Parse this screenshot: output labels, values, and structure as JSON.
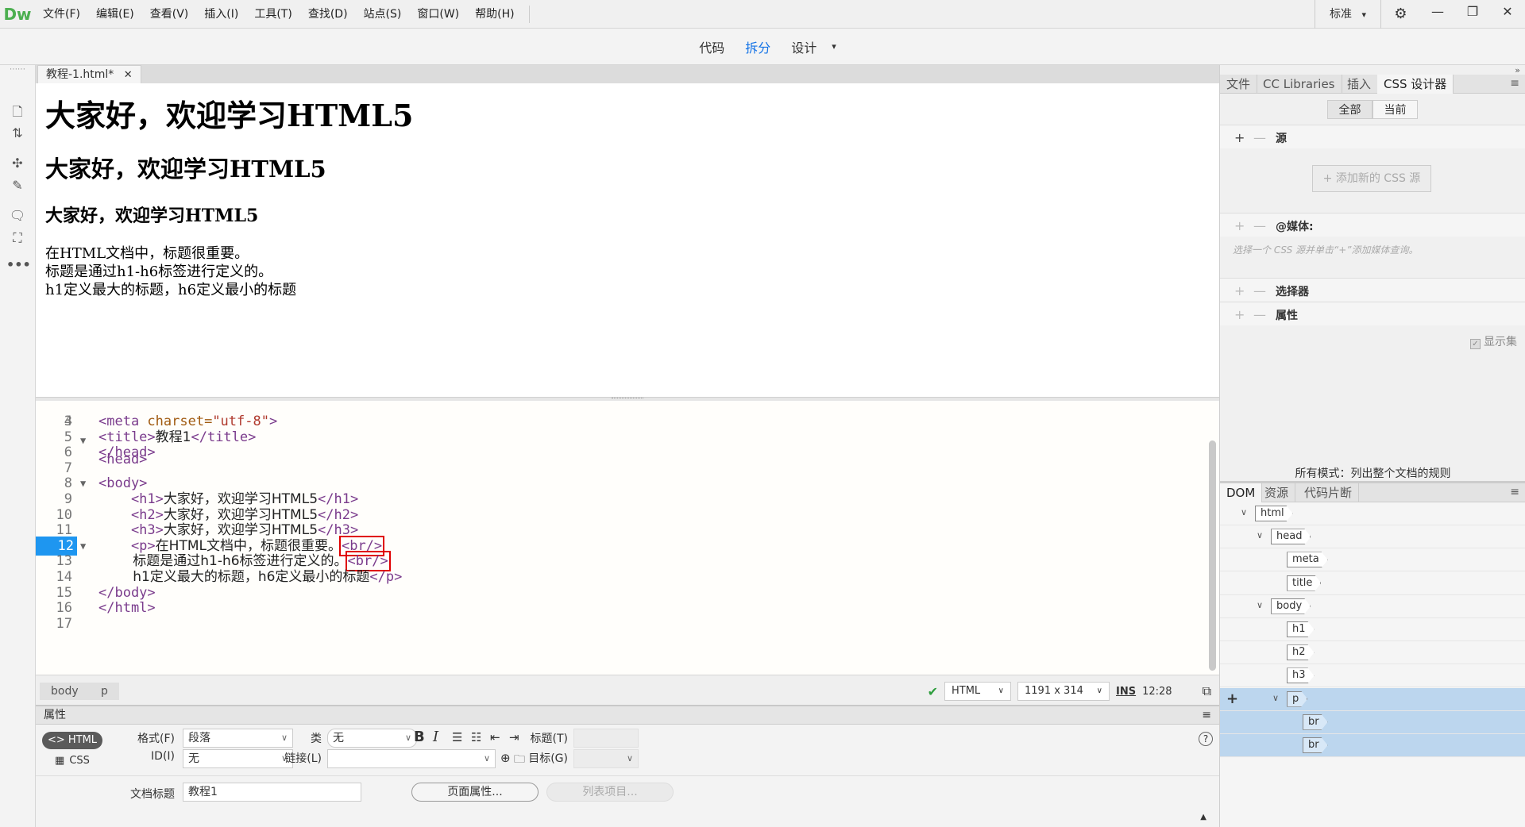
{
  "app": {
    "logo": "Dw"
  },
  "menu": [
    "文件(F)",
    "编辑(E)",
    "查看(V)",
    "插入(I)",
    "工具(T)",
    "查找(D)",
    "站点(S)",
    "窗口(W)",
    "帮助(H)"
  ],
  "workspace": {
    "label": "标准",
    "caret": "▾"
  },
  "window_buttons": {
    "minimize": "—",
    "restore": "❐",
    "close": "✕"
  },
  "view_modes": {
    "code": "代码",
    "split": "拆分",
    "design": "设计",
    "caret": "▾",
    "active": "拆分"
  },
  "document": {
    "tab_label": "教程-1.html*",
    "close": "✕"
  },
  "design_view": {
    "h1": "大家好，欢迎学习HTML5",
    "h2": "大家好，欢迎学习HTML5",
    "h3": "大家好，欢迎学习HTML5",
    "p_lines": [
      "在HTML文档中，标题很重要。",
      "标题是通过h1-h6标签进行定义的。",
      "h1定义最大的标题，h6定义最小的标题"
    ]
  },
  "code_view": {
    "partial_top": "<head>",
    "lines": [
      {
        "num": "4",
        "segments": [
          [
            "tag",
            "<meta "
          ],
          [
            "attr",
            "charset="
          ],
          [
            "str",
            "\"utf-8\""
          ],
          [
            "tag",
            ">"
          ]
        ]
      },
      {
        "num": "5",
        "segments": [
          [
            "tag",
            "<title>"
          ],
          [
            "txt",
            "教程1"
          ],
          [
            "tag",
            "</title>"
          ]
        ]
      },
      {
        "num": "6",
        "segments": [
          [
            "tag",
            "</head>"
          ]
        ]
      },
      {
        "num": "7",
        "segments": []
      },
      {
        "num": "8",
        "fold": "▼",
        "segments": [
          [
            "tag",
            "<body>"
          ]
        ]
      },
      {
        "num": "9",
        "segments": [
          [
            "tag",
            "    <h1>"
          ],
          [
            "txt",
            "大家好，欢迎学习HTML5"
          ],
          [
            "tag",
            "</h1>"
          ]
        ]
      },
      {
        "num": "10",
        "segments": [
          [
            "tag",
            "    <h2>"
          ],
          [
            "txt",
            "大家好，欢迎学习HTML5"
          ],
          [
            "tag",
            "</h2>"
          ]
        ]
      },
      {
        "num": "11",
        "segments": [
          [
            "tag",
            "    <h3>"
          ],
          [
            "txt",
            "大家好，欢迎学习HTML5"
          ],
          [
            "tag",
            "</h3>"
          ]
        ]
      },
      {
        "num": "12",
        "fold": "▼",
        "current": true,
        "segments": [
          [
            "tag",
            "    <p>"
          ],
          [
            "txt",
            "在HTML文档中，标题很重要。"
          ],
          [
            "hl",
            "<br/>"
          ]
        ]
      },
      {
        "num": "13",
        "segments": [
          [
            "txt",
            "        标题是通过h1-h6标签进行定义的。"
          ],
          [
            "hl",
            "<br/>"
          ]
        ]
      },
      {
        "num": "14",
        "segments": [
          [
            "txt",
            "        h1定义最大的标题，h6定义最小的标题"
          ],
          [
            "tag",
            "</p>"
          ]
        ]
      },
      {
        "num": "15",
        "segments": [
          [
            "tag",
            "</body>"
          ]
        ]
      },
      {
        "num": "16",
        "segments": [
          [
            "tag",
            "</html>"
          ]
        ]
      },
      {
        "num": "17",
        "segments": []
      }
    ]
  },
  "status_bar": {
    "breadcrumbs": [
      "body",
      "p"
    ],
    "language": "HTML",
    "size": "1191 x 314",
    "mode": "INS",
    "position": "12:28"
  },
  "properties": {
    "title": "属性",
    "html_btn": "<> HTML",
    "css_btn": "CSS",
    "format_label": "格式(F)",
    "format_value": "段落",
    "id_label": "ID(I)",
    "id_value": "无",
    "class_label": "类",
    "class_value": "无",
    "link_label": "链接(L)",
    "link_value": "",
    "title_label": "标题(T)",
    "target_label": "目标(G)",
    "doc_title_label": "文档标题",
    "doc_title_value": "教程1",
    "page_props_btn": "页面属性...",
    "list_item_btn": "列表项目...",
    "help": "?"
  },
  "right_panel": {
    "tabs": [
      "文件",
      "CC Libraries",
      "插入",
      "CSS 设计器"
    ],
    "active_tab": "CSS 设计器",
    "toggle": [
      "全部",
      "当前"
    ],
    "sources_title": "源",
    "add_source_btn": "+ 添加新的 CSS 源",
    "media_title": "@媒体:",
    "media_hint": "选择一个 CSS 源并单击“+”添加媒体查询。",
    "selectors_title": "选择器",
    "properties_title": "属性",
    "show_set": "显示集",
    "mode_text": "所有模式：列出整个文档的规则",
    "dom_tabs": [
      "DOM",
      "资源",
      "代码片断"
    ],
    "dom_tree": [
      {
        "name": "html",
        "level": 0,
        "toggle": "∨"
      },
      {
        "name": "head",
        "level": 1,
        "toggle": "∨"
      },
      {
        "name": "meta",
        "level": 2
      },
      {
        "name": "title",
        "level": 2
      },
      {
        "name": "body",
        "level": 1,
        "toggle": "∨"
      },
      {
        "name": "h1",
        "level": 2
      },
      {
        "name": "h2",
        "level": 2
      },
      {
        "name": "h3",
        "level": 2
      },
      {
        "name": "p",
        "level": 2,
        "toggle": "∨",
        "selected": true
      },
      {
        "name": "br",
        "level": 3,
        "selected": true
      },
      {
        "name": "br",
        "level": 3,
        "selected": true
      }
    ]
  },
  "colors": {
    "accent": "#1473e6",
    "highlight_box": "#e00000",
    "current_line": "#1e96f0",
    "dom_selected": "#bcd6ee"
  }
}
